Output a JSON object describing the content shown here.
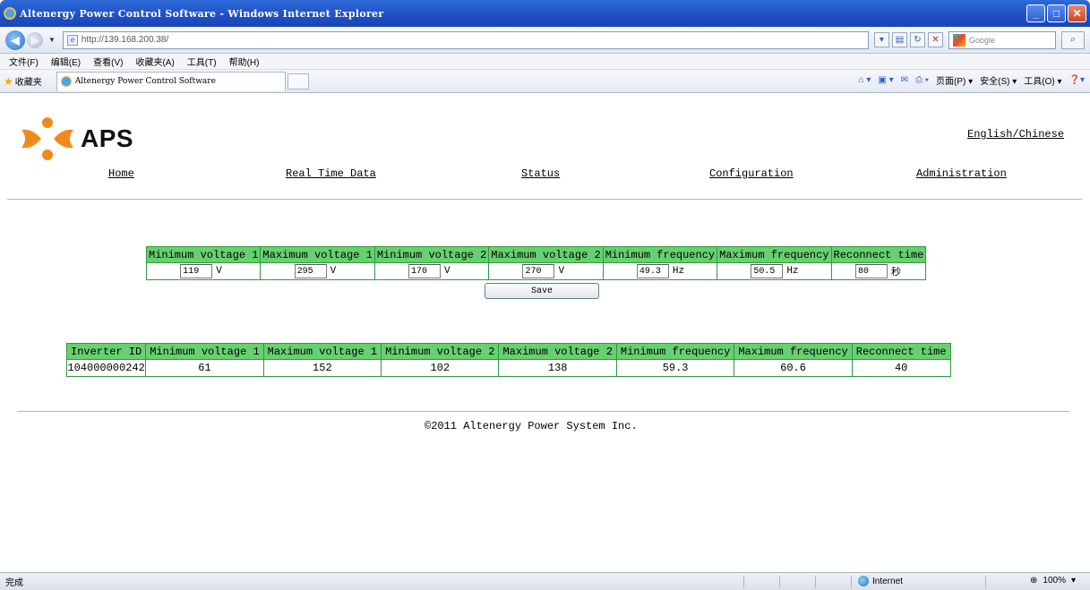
{
  "window": {
    "title": "Altenergy Power Control Software - Windows Internet Explorer",
    "controls": [
      "_",
      "□",
      "✕"
    ]
  },
  "address_bar": {
    "url": "http://139.168.200.38/",
    "search_placeholder": "Google"
  },
  "menu": [
    "文件(F)",
    "编辑(E)",
    "查看(V)",
    "收藏夹(A)",
    "工具(T)",
    "帮助(H)"
  ],
  "favorites": {
    "label": "收藏夹",
    "tab_title": "Altenergy Power Control Software"
  },
  "command_bar": {
    "page": "页面(P) ▾",
    "safety": "安全(S) ▾",
    "tools": "工具(O) ▾"
  },
  "page": {
    "logo_text": "APS",
    "lang_link": "English/Chinese",
    "nav": [
      "Home",
      "Real Time Data",
      "Status",
      "Configuration",
      "Administration"
    ],
    "config": {
      "headers": [
        "Minimum voltage 1",
        "Maximum voltage 1",
        "Minimum voltage 2",
        "Maximum voltage 2",
        "Minimum frequency",
        "Maximum frequency",
        "Reconnect time"
      ],
      "values": [
        {
          "value": "119",
          "unit": "V"
        },
        {
          "value": "295",
          "unit": "V"
        },
        {
          "value": "170",
          "unit": "V"
        },
        {
          "value": "270",
          "unit": "V"
        },
        {
          "value": "49.3",
          "unit": "Hz"
        },
        {
          "value": "50.5",
          "unit": "Hz"
        },
        {
          "value": "80",
          "unit": "秒"
        }
      ],
      "save_label": "Save"
    },
    "inverters": {
      "headers": [
        "Inverter ID",
        "Minimum voltage 1",
        "Maximum voltage 1",
        "Minimum voltage 2",
        "Maximum voltage 2",
        "Minimum frequency",
        "Maximum frequency",
        "Reconnect time"
      ],
      "rows": [
        [
          "104000000242",
          "61",
          "152",
          "102",
          "138",
          "59.3",
          "60.6",
          "40"
        ]
      ]
    },
    "copyright": "©2011 Altenergy Power System Inc."
  },
  "status_bar": {
    "status": "完成",
    "zone": "Internet",
    "zoom": "100%"
  },
  "colors": {
    "table_header": "#67d06f",
    "table_border": "#2e9a3e",
    "logo_orange": "#f08a1e",
    "titlebar_blue": "#1f4fc5"
  }
}
